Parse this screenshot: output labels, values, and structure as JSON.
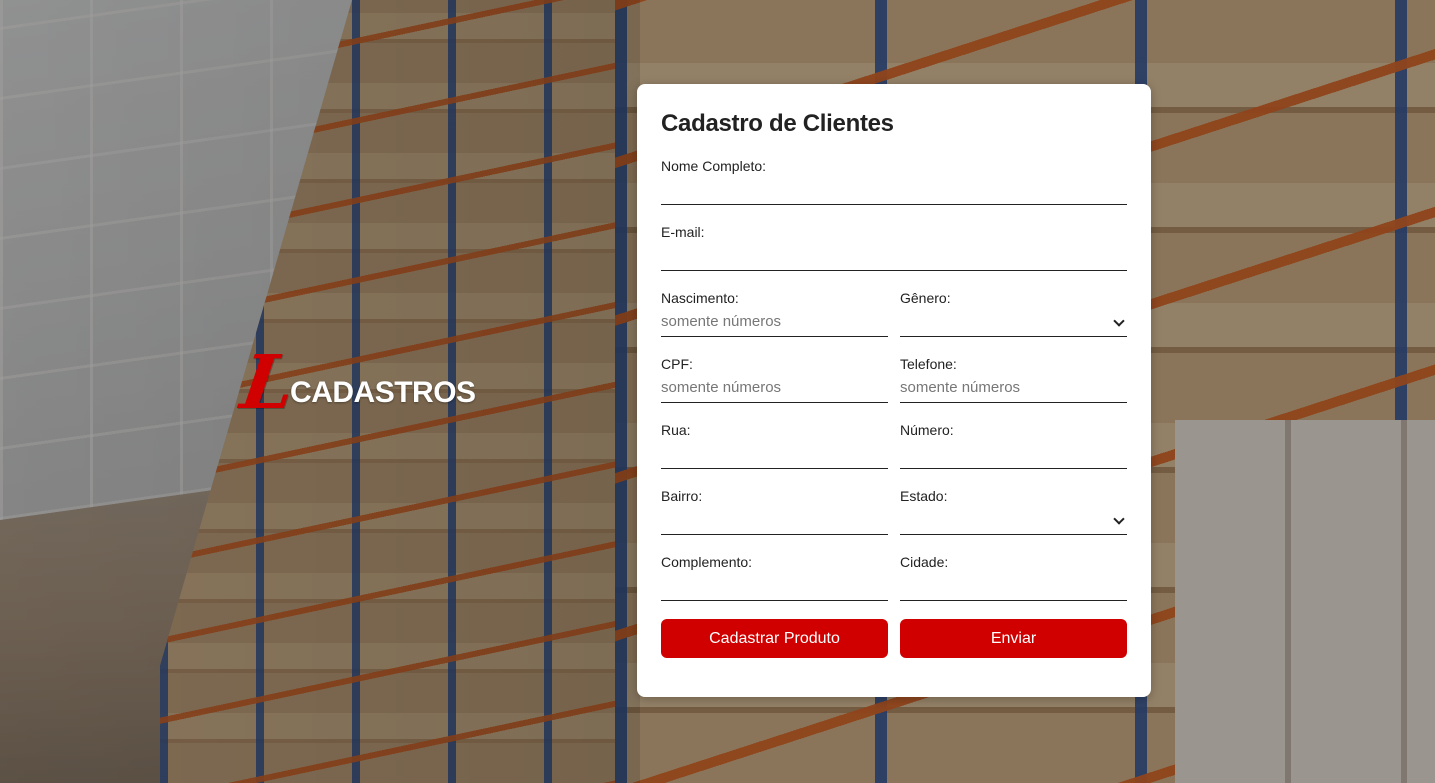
{
  "brand": {
    "logo_letter": "L",
    "name": "CADASTROS"
  },
  "form": {
    "title": "Cadastro de Clientes",
    "fields": {
      "nome": {
        "label": "Nome Completo:",
        "placeholder": ""
      },
      "email": {
        "label": "E-mail:",
        "placeholder": ""
      },
      "nascimento": {
        "label": "Nascimento:",
        "placeholder": "somente números"
      },
      "genero": {
        "label": "Gênero:",
        "value": ""
      },
      "cpf": {
        "label": "CPF:",
        "placeholder": "somente números"
      },
      "telefone": {
        "label": "Telefone:",
        "placeholder": "somente números"
      },
      "rua": {
        "label": "Rua:",
        "placeholder": ""
      },
      "numero": {
        "label": "Número:",
        "placeholder": ""
      },
      "bairro": {
        "label": "Bairro:",
        "placeholder": ""
      },
      "estado": {
        "label": "Estado:",
        "value": ""
      },
      "complemento": {
        "label": "Complemento:",
        "placeholder": ""
      },
      "cidade": {
        "label": "Cidade:",
        "placeholder": ""
      }
    },
    "buttons": {
      "cadastrar_produto": "Cadastrar Produto",
      "enviar": "Enviar"
    }
  },
  "colors": {
    "accent": "#d00000",
    "card_bg": "#ffffff",
    "text": "#222222",
    "placeholder": "#777777"
  },
  "icons": {
    "select_arrow": "chevron-down-icon"
  }
}
